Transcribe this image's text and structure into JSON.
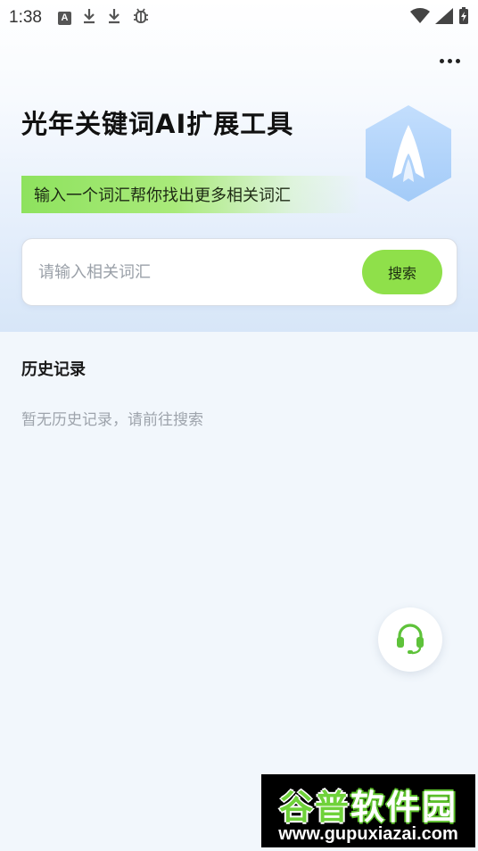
{
  "status_bar": {
    "time": "1:38",
    "left_icons": [
      "a-notification-icon",
      "download-icon",
      "download-icon",
      "bug-icon"
    ],
    "right_icons": [
      "wifi-icon",
      "signal-icon",
      "battery-charging-icon"
    ]
  },
  "header": {
    "title": "光年关键词AI扩展工具",
    "tagline": "输入一个词汇帮你找出更多相关词汇",
    "logo": "rocket-hexagon-logo"
  },
  "search": {
    "placeholder": "请输入相关词汇",
    "value": "",
    "button_label": "搜索"
  },
  "history": {
    "title": "历史记录",
    "empty_text": "暂无历史记录，请前往搜索"
  },
  "support": {
    "icon": "headset-icon"
  },
  "watermark": {
    "line1_a": "谷普",
    "line1_b": "软件园",
    "line2": "www.gupuxiazai.com"
  },
  "colors": {
    "accent_green": "#8fe04a",
    "hero_blue": "#d7e6f8",
    "logo_blue": "#a9d0fb"
  }
}
